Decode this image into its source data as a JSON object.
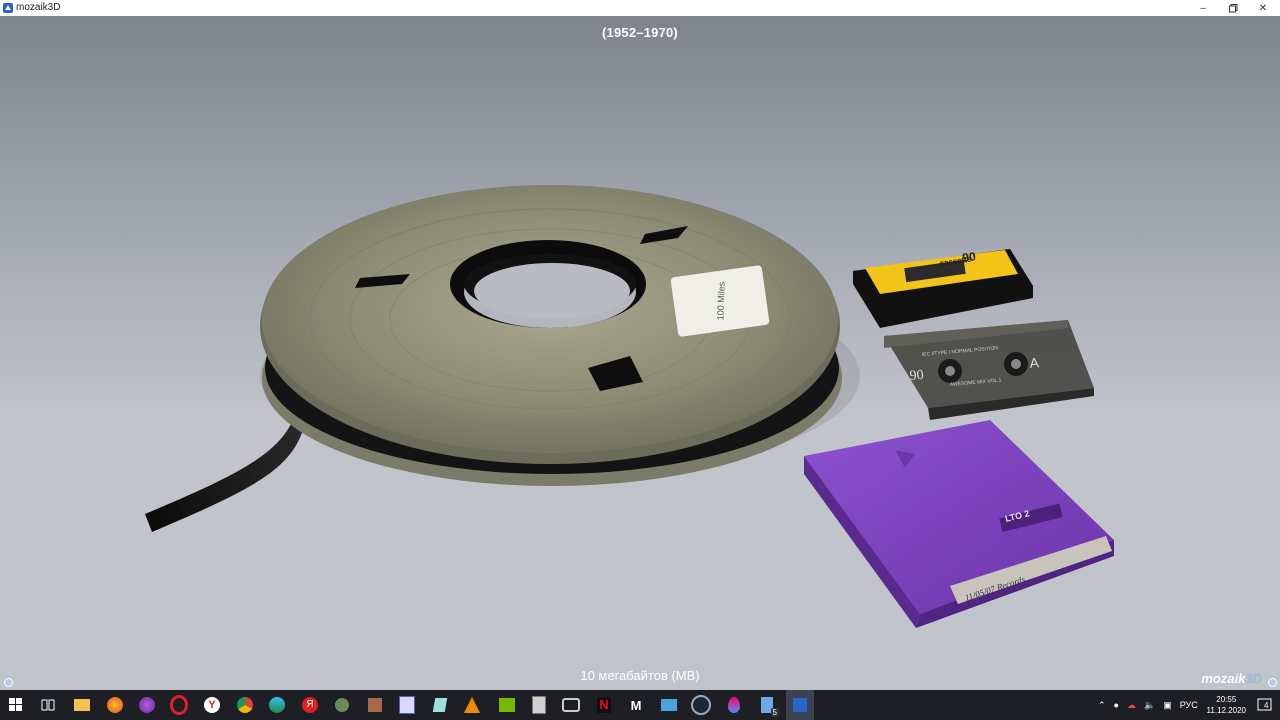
{
  "window": {
    "title": "mozaik3D",
    "app_icon": "mozaik-app-icon",
    "controls": [
      "minimize-icon",
      "maximize-icon",
      "close-icon"
    ]
  },
  "scene": {
    "era_label": "(1952–1970)",
    "caption": "10 мегабайтов (MB)",
    "brand_text": "mozaik",
    "brand_accent": "3D",
    "reel_label_text": "100 Miles",
    "cassette1": {
      "brand": "cassette",
      "number": "90"
    },
    "cassette2": {
      "number": "90",
      "side": "A",
      "text": "IEC I/TYPE I NORMAL POSITION",
      "sub": "AWESOME MIX VOL.1"
    },
    "lto": {
      "label": "LTO 2",
      "handwritten": "11/05/07 Records"
    }
  },
  "taskbar": {
    "icons": [
      "windows-start-icon",
      "task-view-icon",
      "file-explorer-icon",
      "firefox-icon",
      "browser-icon",
      "opera-icon",
      "yandex-icon",
      "chrome-icon",
      "edge-icon",
      "yandex-browser-icon",
      "app-icon",
      "app-icon-2",
      "app-icon-3",
      "app-icon-4",
      "vlc-icon",
      "nvidia-icon",
      "calculator-icon",
      "camera-icon",
      "netflix-icon",
      "app-m-icon",
      "app-icon-5",
      "steam-icon",
      "app-drop-icon",
      "app-icon-6",
      "mozaik-taskbar-icon"
    ],
    "badge": "5",
    "tray": {
      "language": "РУС",
      "time": "20:55",
      "date": "11.12.2020",
      "notification_count": "4"
    }
  },
  "colors": {
    "background_top": "#7f838e",
    "background_bottom": "#c0c3ca",
    "taskbar": "#1d1f24",
    "cassette_yellow": "#f2c318",
    "lto_purple": "#7b3fb8"
  }
}
